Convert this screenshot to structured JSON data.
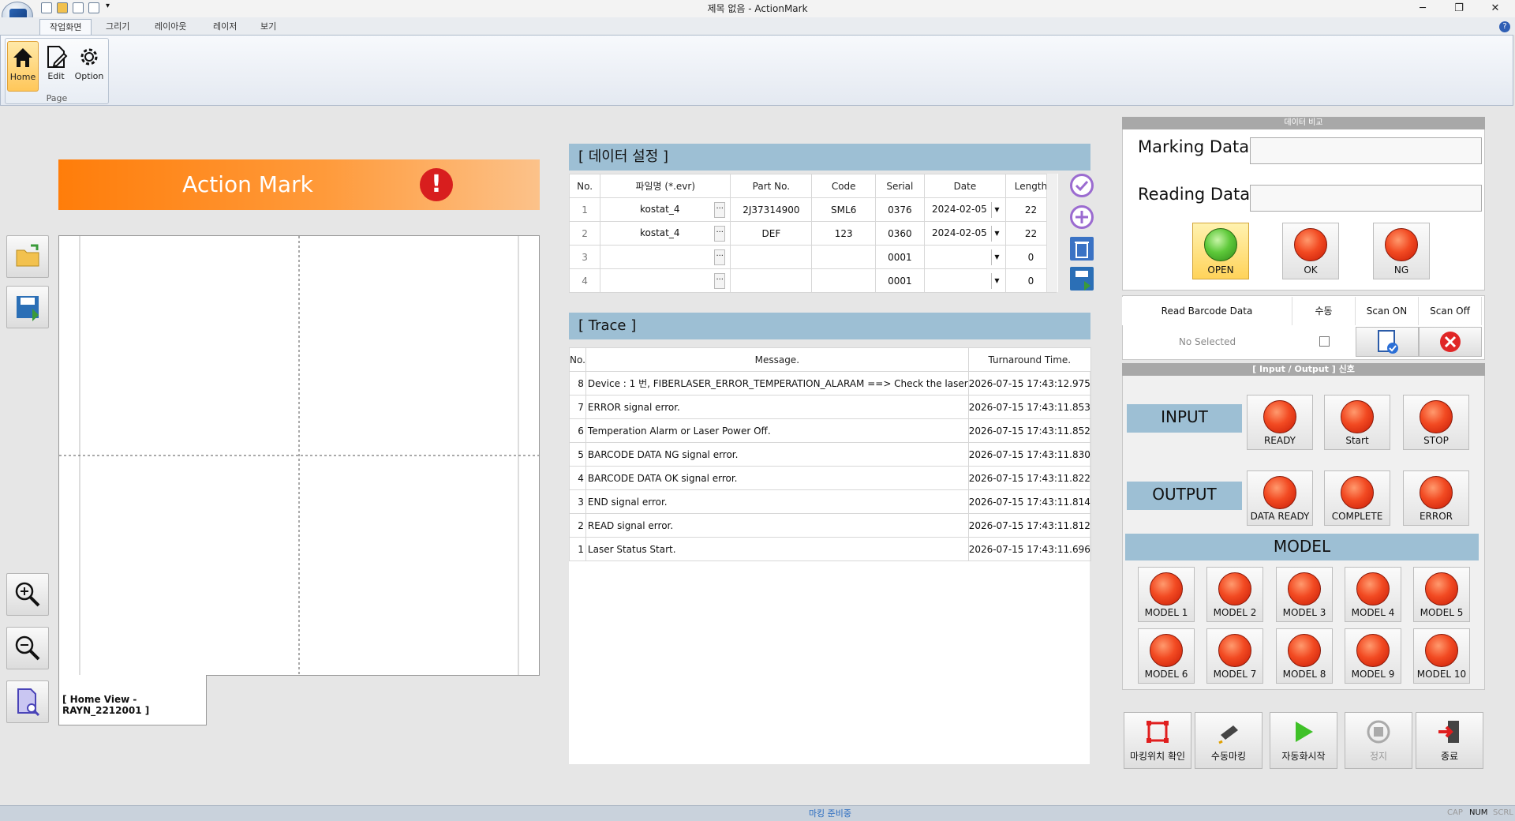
{
  "window": {
    "title": "제목 없음 - ActionMark"
  },
  "menu_tabs": [
    "작업화면",
    "그리기",
    "레이아웃",
    "레이저",
    "보기"
  ],
  "ribbon": {
    "group_label": "Page",
    "buttons": [
      "Home",
      "Edit",
      "Option"
    ]
  },
  "banner": {
    "title": "Action Mark"
  },
  "canvas": {
    "view_tab": "[ Home View - RAYN_2212001 ]"
  },
  "data_setup": {
    "title": "[ 데이터 설정 ]",
    "columns": [
      "No.",
      "파일명 (*.evr)",
      "Part No.",
      "Code",
      "Serial",
      "Date",
      "Length"
    ],
    "rows": [
      {
        "no": "1",
        "file": "kostat_4",
        "part": "2J37314900",
        "code": "SML6",
        "serial": "0376",
        "date": "2024-02-05",
        "length": "22"
      },
      {
        "no": "2",
        "file": "kostat_4",
        "part": "DEF",
        "code": "123",
        "serial": "0360",
        "date": "2024-02-05",
        "length": "22"
      },
      {
        "no": "3",
        "file": "",
        "part": "",
        "code": "",
        "serial": "0001",
        "date": "",
        "length": "0"
      },
      {
        "no": "4",
        "file": "",
        "part": "",
        "code": "",
        "serial": "0001",
        "date": "",
        "length": "0"
      }
    ]
  },
  "trace": {
    "title": "[ Trace ]",
    "columns": [
      "No.",
      "Message.",
      "Turnaround Time."
    ],
    "rows": [
      {
        "no": "8",
        "msg": "Device : 1 번,  FIBERLASER_ERROR_TEMPERATION_ALARAM ==> Check the laser",
        "time": "2026-07-15 17:43:12.975"
      },
      {
        "no": "7",
        "msg": "ERROR signal error.",
        "time": "2026-07-15 17:43:11.853"
      },
      {
        "no": "6",
        "msg": "Temperation Alarm or Laser Power Off.",
        "time": "2026-07-15 17:43:11.852"
      },
      {
        "no": "5",
        "msg": "BARCODE DATA NG signal error.",
        "time": "2026-07-15 17:43:11.830"
      },
      {
        "no": "4",
        "msg": "BARCODE DATA OK signal error.",
        "time": "2026-07-15 17:43:11.822"
      },
      {
        "no": "3",
        "msg": "END signal error.",
        "time": "2026-07-15 17:43:11.814"
      },
      {
        "no": "2",
        "msg": "READ signal error.",
        "time": "2026-07-15 17:43:11.812"
      },
      {
        "no": "1",
        "msg": "Laser Status Start.",
        "time": "2026-07-15 17:43:11.696"
      }
    ]
  },
  "compare": {
    "title": "데이터 비교",
    "marking_label": "Marking Data",
    "reading_label": "Reading Data",
    "marking_value": "",
    "reading_value": "",
    "open_label": "OPEN",
    "ok_label": "OK",
    "ng_label": "NG"
  },
  "barcode": {
    "col_read": "Read Barcode Data",
    "col_manual": "수동",
    "col_scan_on": "Scan ON",
    "col_scan_off": "Scan Off",
    "value": "No Selected"
  },
  "io": {
    "title": "[ Input / Output ] 신호",
    "input_label": "INPUT",
    "output_label": "OUTPUT",
    "inputs": [
      "READY",
      "Start",
      "STOP"
    ],
    "outputs": [
      "DATA READY",
      "COMPLETE",
      "ERROR"
    ],
    "model_label": "MODEL",
    "models": [
      "MODEL 1",
      "MODEL 2",
      "MODEL 3",
      "MODEL 4",
      "MODEL 5",
      "MODEL 6",
      "MODEL 7",
      "MODEL 8",
      "MODEL 9",
      "MODEL 10"
    ]
  },
  "actions": [
    "마킹위치 확인",
    "수동마킹",
    "자동화시작",
    "정지",
    "종료"
  ],
  "status": {
    "text": "마킹 준비중",
    "indicators": [
      "CAP",
      "NUM",
      "SCRL"
    ]
  },
  "colors": {
    "accent_orange": "#ff7d0a",
    "section_blue": "#9dbfd4",
    "lamp_red": "#f24a22",
    "lamp_green": "#5ec93a"
  }
}
